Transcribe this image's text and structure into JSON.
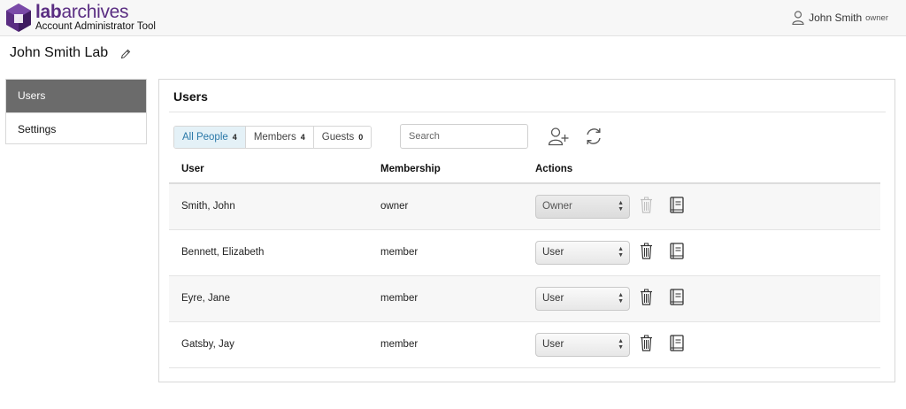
{
  "header": {
    "brand_bold": "lab",
    "brand_rest": "archives",
    "subtitle": "Account Administrator Tool",
    "user_name": "John Smith",
    "user_role": "owner"
  },
  "lab": {
    "title": "John Smith Lab"
  },
  "sidebar": {
    "items": [
      {
        "label": "Users",
        "active": true
      },
      {
        "label": "Settings",
        "active": false
      }
    ]
  },
  "main": {
    "title": "Users",
    "tabs": [
      {
        "label": "All People",
        "count": "4",
        "active": true
      },
      {
        "label": "Members",
        "count": "4",
        "active": false
      },
      {
        "label": "Guests",
        "count": "0",
        "active": false
      }
    ],
    "search": {
      "placeholder": "Search",
      "value": ""
    },
    "columns": {
      "user": "User",
      "membership": "Membership",
      "actions": "Actions"
    },
    "rows": [
      {
        "user": "Smith, John",
        "membership": "owner",
        "role": "Owner",
        "delete_enabled": false
      },
      {
        "user": "Bennett, Elizabeth",
        "membership": "member",
        "role": "User",
        "delete_enabled": true
      },
      {
        "user": "Eyre, Jane",
        "membership": "member",
        "role": "User",
        "delete_enabled": true
      },
      {
        "user": "Gatsby, Jay",
        "membership": "member",
        "role": "User",
        "delete_enabled": true
      }
    ]
  },
  "colors": {
    "brand": "#5a2d82",
    "active_tab_bg": "#e4f1f7",
    "active_tab_text": "#2a78a8",
    "sidebar_active": "#6b6b6b"
  },
  "icons": [
    "labarchives-logo-icon",
    "user-icon",
    "pencil-icon",
    "add-user-icon",
    "refresh-icon",
    "trash-icon",
    "notebook-icon"
  ]
}
